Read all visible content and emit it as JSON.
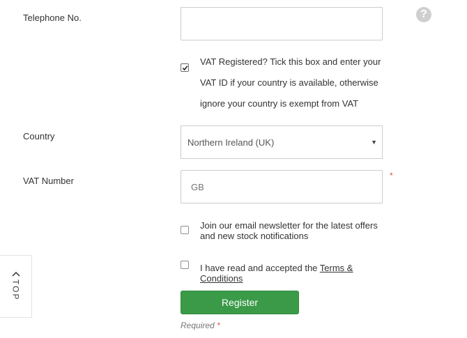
{
  "telephone": {
    "label": "Telephone No.",
    "value": ""
  },
  "vat_registered": {
    "checked": true,
    "lines": [
      "VAT Registered? Tick this box and enter your",
      "VAT ID if your country is available, otherwise",
      "ignore your country is exempt from VAT"
    ]
  },
  "country": {
    "label": "Country",
    "selected": "Northern Ireland (UK)"
  },
  "vat_number": {
    "label": "VAT Number",
    "value": "",
    "placeholder": "GB",
    "required_mark": "*"
  },
  "newsletter": {
    "checked": false,
    "line1": "Join our email newsletter for the latest offers",
    "line2": "and new stock notifications"
  },
  "terms": {
    "checked": false,
    "prefix": "I have read and accepted the ",
    "link_line1": "Terms &",
    "link_line2": "Conditions"
  },
  "register_button": {
    "label": "Register"
  },
  "required_note": {
    "label": "Required",
    "mark": "*"
  },
  "help_icon": {
    "glyph": "?"
  },
  "top_tab": {
    "label": "TOP",
    "icon": "chevron-up-icon"
  },
  "colors": {
    "accent": "#3a9a48",
    "required": "#d9534f",
    "border": "#cccccc"
  }
}
